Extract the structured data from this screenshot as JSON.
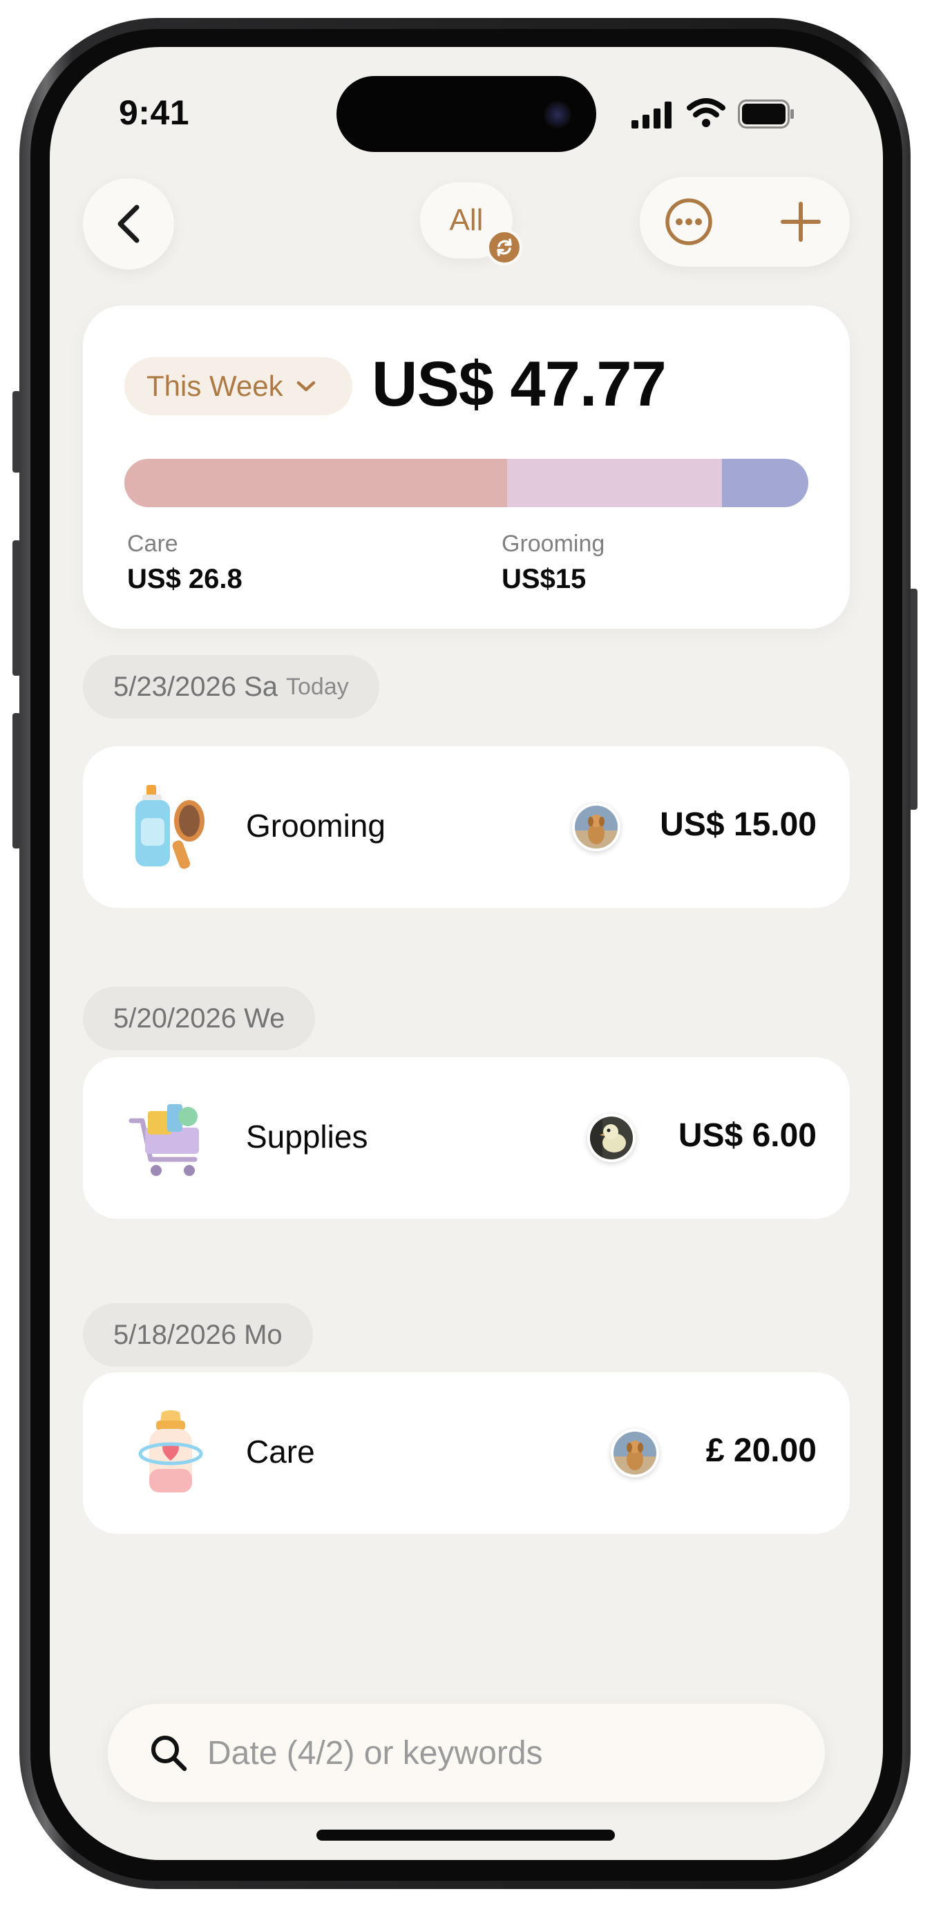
{
  "status_bar": {
    "time": "9:41"
  },
  "header": {
    "back_icon": "chevron-left-icon",
    "filter_label": "All",
    "sync_icon": "sync-icon",
    "more_icon": "ellipsis-circle-icon",
    "add_icon": "plus-icon"
  },
  "summary": {
    "period_label": "This Week",
    "period_icon": "chevron-down-icon",
    "total": "US$ 47.77",
    "breakdown": [
      {
        "label": "Care",
        "value": "US$ 26.8",
        "fraction": 0.56,
        "color": "#dfb2b0"
      },
      {
        "label": "Grooming",
        "value": "US$15",
        "fraction": 0.314,
        "color": "#e2c9db"
      },
      {
        "label": "",
        "value": "",
        "fraction": 0.126,
        "color": "#a3a7d4"
      }
    ]
  },
  "groups": [
    {
      "date": "5/23/2026 Sa",
      "date_note": "Today",
      "items": [
        {
          "category": "Grooming",
          "icon": "grooming-kit-icon",
          "avatar": "dog-avatar",
          "amount": "US$ 15.00"
        }
      ]
    },
    {
      "date": "5/20/2026 We",
      "date_note": "",
      "items": [
        {
          "category": "Supplies",
          "icon": "shopping-cart-icon",
          "avatar": "bird-avatar",
          "amount": "US$ 6.00"
        }
      ]
    },
    {
      "date": "5/18/2026 Mo",
      "date_note": "",
      "items": [
        {
          "category": "Care",
          "icon": "baby-bottle-icon",
          "avatar": "dog-avatar",
          "amount": "£ 20.00"
        }
      ]
    }
  ],
  "search": {
    "placeholder": "Date (4/2) or keywords",
    "value": "",
    "icon": "search-icon"
  },
  "colors": {
    "accent": "#ad7a45",
    "background": "#f3f1ee",
    "card": "#ffffff"
  }
}
